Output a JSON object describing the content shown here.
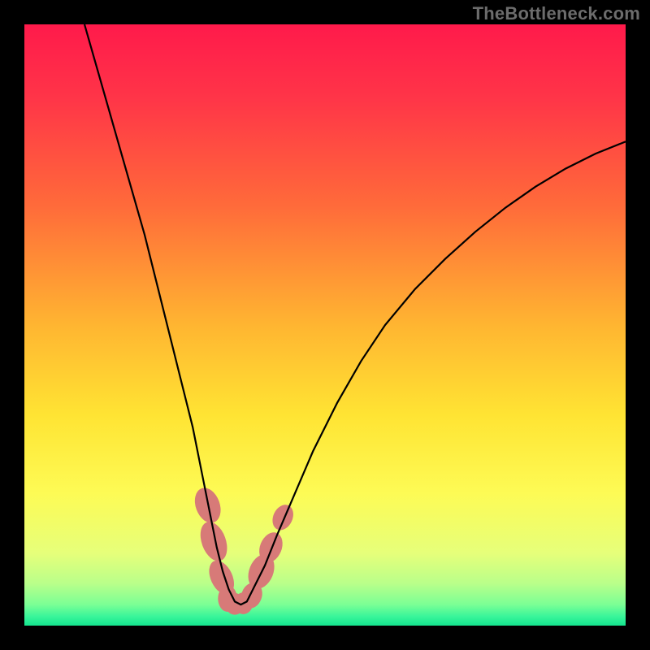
{
  "watermark": "TheBottleneck.com",
  "chart_data": {
    "type": "line",
    "title": "",
    "xlabel": "",
    "ylabel": "",
    "xlim": [
      0,
      100
    ],
    "ylim": [
      0,
      100
    ],
    "background_gradient": {
      "stops": [
        {
          "offset": 0.0,
          "color": "#ff1a4b"
        },
        {
          "offset": 0.12,
          "color": "#ff3448"
        },
        {
          "offset": 0.3,
          "color": "#ff6a3a"
        },
        {
          "offset": 0.5,
          "color": "#ffb531"
        },
        {
          "offset": 0.65,
          "color": "#ffe433"
        },
        {
          "offset": 0.78,
          "color": "#fdfb55"
        },
        {
          "offset": 0.88,
          "color": "#e6ff7a"
        },
        {
          "offset": 0.93,
          "color": "#b9ff8a"
        },
        {
          "offset": 0.965,
          "color": "#7bff95"
        },
        {
          "offset": 0.985,
          "color": "#38f59a"
        },
        {
          "offset": 1.0,
          "color": "#14e58f"
        }
      ]
    },
    "series": [
      {
        "name": "bottleneck-curve",
        "stroke": "#000000",
        "stroke_width": 2.2,
        "x": [
          10,
          12,
          14,
          16,
          18,
          20,
          22,
          24,
          26,
          28,
          30,
          31,
          32,
          33,
          34,
          35,
          36,
          37,
          38,
          40,
          42,
          45,
          48,
          52,
          56,
          60,
          65,
          70,
          75,
          80,
          85,
          90,
          95,
          100
        ],
        "y": [
          100,
          93,
          86,
          79,
          72,
          65,
          57,
          49,
          41,
          33,
          23,
          18,
          13,
          9,
          6,
          4,
          3.5,
          4,
          6,
          10,
          15,
          22,
          29,
          37,
          44,
          50,
          56,
          61,
          65.5,
          69.5,
          73,
          76,
          78.5,
          80.5
        ]
      }
    ],
    "markers": {
      "name": "bottom-lobes",
      "fill": "#d77a78",
      "points": [
        {
          "cx": 30.5,
          "cy": 20,
          "rx": 2.0,
          "ry": 3.0,
          "rot": -20
        },
        {
          "cx": 31.5,
          "cy": 14,
          "rx": 2.0,
          "ry": 3.4,
          "rot": -20
        },
        {
          "cx": 32.8,
          "cy": 8,
          "rx": 1.8,
          "ry": 3.0,
          "rot": -25
        },
        {
          "cx": 33.8,
          "cy": 4.5,
          "rx": 1.6,
          "ry": 2.2,
          "rot": 0
        },
        {
          "cx": 35.0,
          "cy": 3.6,
          "rx": 1.6,
          "ry": 1.8,
          "rot": 0
        },
        {
          "cx": 36.4,
          "cy": 3.7,
          "rx": 1.6,
          "ry": 1.8,
          "rot": 0
        },
        {
          "cx": 37.8,
          "cy": 5.0,
          "rx": 1.7,
          "ry": 2.2,
          "rot": 20
        },
        {
          "cx": 39.4,
          "cy": 9.0,
          "rx": 2.0,
          "ry": 3.0,
          "rot": 22
        },
        {
          "cx": 41.0,
          "cy": 13.0,
          "rx": 1.8,
          "ry": 2.6,
          "rot": 22
        },
        {
          "cx": 43.0,
          "cy": 18.0,
          "rx": 1.6,
          "ry": 2.2,
          "rot": 25
        }
      ]
    }
  }
}
